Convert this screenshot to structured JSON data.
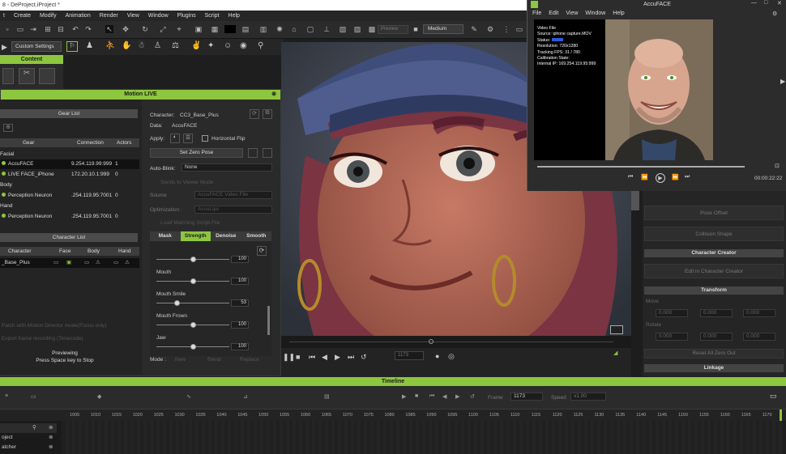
{
  "window": {
    "title": "8 - DeProject.iProject *"
  },
  "menu": [
    "t",
    "Create",
    "Modify",
    "Animation",
    "Render",
    "View",
    "Window",
    "Plugins",
    "Script",
    "Help"
  ],
  "toolbar": {
    "custom_settings": "Custom Settings",
    "preview_label": "Preview",
    "quality": "Medium"
  },
  "content_panel": {
    "title": "Content"
  },
  "motion_live": {
    "title": "Motion LIVE",
    "gear_list": {
      "title": "Gear List",
      "columns": [
        "Gear",
        "Connection",
        "Actors"
      ],
      "groups": [
        {
          "name": "Facial",
          "items": [
            {
              "gear": "AccuFACE",
              "connection": "9.254.119.99:999",
              "actors": "1"
            },
            {
              "gear": "LIVE FACE_iPhone",
              "connection": "172.20.10.1:999",
              "actors": "0"
            }
          ]
        },
        {
          "name": "Body",
          "items": [
            {
              "gear": "Perception Neuron",
              "connection": ".254.119.95:7001",
              "actors": "0"
            }
          ]
        },
        {
          "name": "Hand",
          "items": [
            {
              "gear": "Perception Neuron",
              "connection": ".254.119.95:7001",
              "actors": "0"
            }
          ]
        }
      ]
    },
    "character_list": {
      "title": "Character List",
      "columns": [
        "Character",
        "Face",
        "Body",
        "Hand"
      ],
      "rows": [
        {
          "character": "_Base_Plus"
        }
      ]
    },
    "hints": [
      "Patch with Motion Director mode(Focus only)",
      "Export frame recording (Timecode)"
    ],
    "status": {
      "line1": "Previewing",
      "line2": "Press Space key to Stop"
    },
    "character": {
      "label": "Character:",
      "value": "CC3_Base_Plus"
    },
    "data": {
      "label": "Data:",
      "value": "AccuFACE"
    },
    "apply": {
      "label": "Apply:",
      "flip": "Horizontal Flip"
    },
    "zero_pose": "Set Zero Pose",
    "auto_blink": {
      "label": "Auto-Blink:",
      "value": "None"
    },
    "disabled_opt1": "Sends to Viewer Mode",
    "source": {
      "label": "Source",
      "value": "AccuFACE Video File"
    },
    "optimization": {
      "label": "Optimization :",
      "value": "AccuLips"
    },
    "disabled_opt2": "Load Matching Script File",
    "tabs": [
      "Mask",
      "Strength",
      "Denoise",
      "Smooth"
    ],
    "sliders": [
      {
        "name": "",
        "value": "100",
        "pct": 0.5
      },
      {
        "name": "Mouth",
        "value": "100",
        "pct": 0.5
      },
      {
        "name": "Mouth Smile",
        "value": "53",
        "pct": 0.28
      },
      {
        "name": "Mouth Frown",
        "value": "100",
        "pct": 0.5
      },
      {
        "name": "Jaw",
        "value": "100",
        "pct": 0.5
      }
    ],
    "mode": {
      "label": "Mode :",
      "options": [
        "New",
        "Blend",
        "Replace"
      ]
    }
  },
  "right_panel": {
    "buttons": [
      "Pose Offset",
      "Collision Shape"
    ],
    "character_creator": "Character Creator",
    "edit_button": "Edit in Character Creator",
    "transform": "Transform",
    "move": "Move",
    "rotate": "Rotate",
    "coord_x": "0.000",
    "reset": "Reset All Zero Out",
    "linkage": "Linkage"
  },
  "viewport_controls": {
    "frame": "1173"
  },
  "timeline": {
    "title": "Timeline",
    "frame": "1173",
    "frame_label": "Frame",
    "speed_label": "Speed",
    "speed": "x1.00",
    "ruler": [
      "1005",
      "1010",
      "1015",
      "1020",
      "1025",
      "1030",
      "1035",
      "1040",
      "1045",
      "1050",
      "1055",
      "1060",
      "1065",
      "1070",
      "1075",
      "1080",
      "1085",
      "1090",
      "1095",
      "1100",
      "1105",
      "1110",
      "1115",
      "1120",
      "1125",
      "1130",
      "1135",
      "1140",
      "1145",
      "1150",
      "1155",
      "1160",
      "1165",
      "1170"
    ],
    "tracks": [
      "oject",
      "atcher"
    ]
  },
  "accuface": {
    "title": "AccuFACE",
    "menu": [
      "File",
      "Edit",
      "View",
      "Window",
      "Help"
    ],
    "info": [
      "Video File",
      "Source: iphone capture.MOV",
      "Status:",
      "Resolution: 720x1280",
      "Tracking FPS: 31 / 780",
      "Calibration State:",
      "Internal IP: 169.254.119.95:999"
    ],
    "time": "00:00:22:22"
  },
  "colors": {
    "accent": "#8dc63f",
    "panel": "#2a2a2a"
  }
}
